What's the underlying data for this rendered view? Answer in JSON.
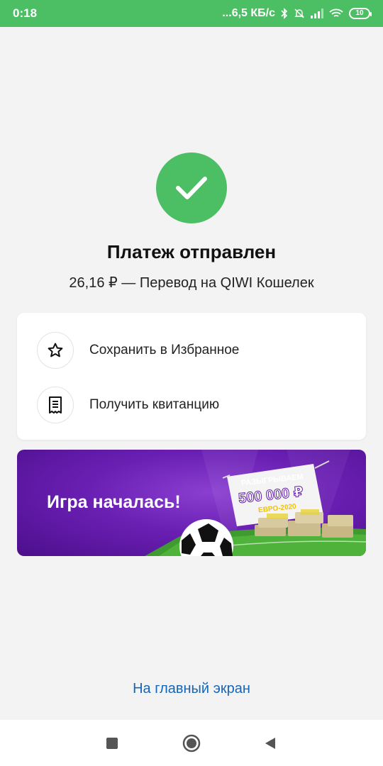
{
  "status_bar": {
    "time": "0:18",
    "speed": "...6,5 КБ/с",
    "battery": "10",
    "icons": [
      "bluetooth-icon",
      "mute-icon",
      "signal-icon",
      "wifi-icon",
      "battery-icon"
    ]
  },
  "result": {
    "icon": "check-icon",
    "title": "Платеж отправлен",
    "subtitle": "26,16 ₽ — Перевод на QIWI Кошелек"
  },
  "actions": [
    {
      "icon": "star-icon",
      "label": "Сохранить в Избранное"
    },
    {
      "icon": "receipt-icon",
      "label": "Получить квитанцию"
    }
  ],
  "banner": {
    "title": "Игра началась!",
    "prize_top": "РАЗЫГРЫВАЕМ",
    "prize_amount": "500 000 ₽",
    "prize_sub": "ЕВРО-2020"
  },
  "home_link": "На главный экран",
  "nav": {
    "icons": [
      "recent-apps-icon",
      "home-icon",
      "back-icon"
    ]
  },
  "colors": {
    "accent_green": "#4cbe63",
    "link_blue": "#1565b8",
    "banner_purple": "#6a1fb3"
  }
}
